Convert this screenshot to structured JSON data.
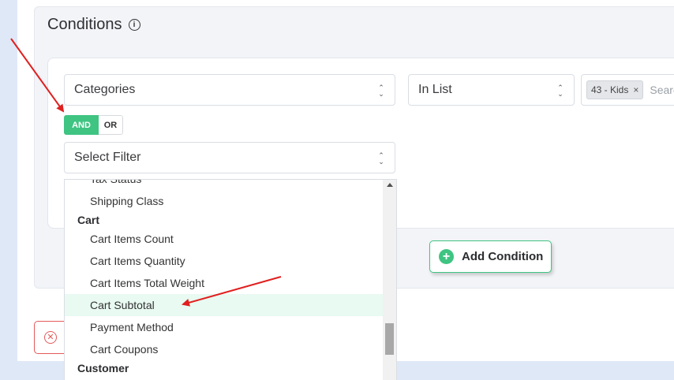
{
  "panel": {
    "title": "Conditions",
    "info_icon": "info-icon"
  },
  "condition": {
    "field": "Categories",
    "operator": "In List",
    "tags": [
      {
        "label": "43 - Kids"
      }
    ],
    "tag_remove": "×",
    "search_placeholder": "Search"
  },
  "logic": {
    "and_label": "AND",
    "or_label": "OR",
    "selected": "AND"
  },
  "filter_select": {
    "placeholder": "Select Filter"
  },
  "dropdown": {
    "partial_top_item": "Tax Status",
    "items_before_cart": [
      "Shipping Class"
    ],
    "groups": [
      {
        "name": "Cart",
        "items": [
          "Cart Items Count",
          "Cart Items Quantity",
          "Cart Items Total Weight",
          "Cart Subtotal",
          "Payment Method",
          "Cart Coupons"
        ]
      },
      {
        "name": "Customer",
        "items": []
      }
    ],
    "highlighted": "Cart Subtotal"
  },
  "actions": {
    "add_condition": "Add Condition"
  },
  "colors": {
    "accent_green": "#3fc482",
    "annotation_red": "#e02020",
    "danger_red": "#e35a5a"
  }
}
